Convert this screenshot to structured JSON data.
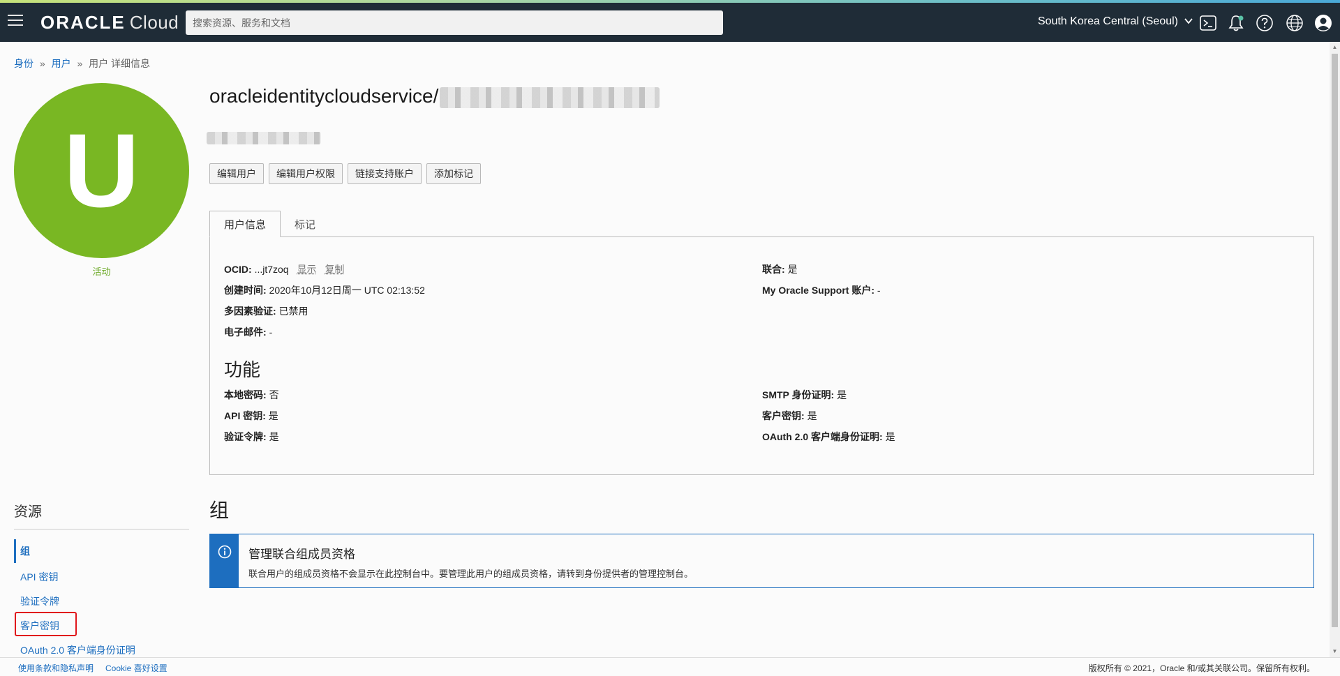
{
  "header": {
    "logo_brand": "ORACLE",
    "logo_product": "Cloud",
    "search_placeholder": "搜索资源、服务和文档",
    "region": "South Korea Central (Seoul)"
  },
  "breadcrumb": {
    "identity": "身份",
    "users": "用户",
    "current": "用户 详细信息",
    "separator": "»"
  },
  "user": {
    "avatar_letter": "U",
    "status": "活动",
    "title_prefix": "oracleidentitycloudservice/"
  },
  "actions": [
    "编辑用户",
    "编辑用户权限",
    "链接支持账户",
    "添加标记"
  ],
  "tabs": [
    "用户信息",
    "标记"
  ],
  "user_info": {
    "ocid_label": "OCID:",
    "ocid_value": "...jt7zoq",
    "show": "显示",
    "copy": "复制",
    "created_label": "创建时间:",
    "created_value": "2020年10月12日周一 UTC 02:13:52",
    "mfa_label": "多因素验证:",
    "mfa_value": "已禁用",
    "email_label": "电子邮件:",
    "email_value": "-",
    "federated_label": "联合:",
    "federated_value": "是",
    "mos_label": "My Oracle Support 账户:",
    "mos_value": "-"
  },
  "capabilities": {
    "heading": "功能",
    "local_password_label": "本地密码:",
    "local_password_value": "否",
    "api_keys_label": "API 密钥:",
    "api_keys_value": "是",
    "auth_tokens_label": "验证令牌:",
    "auth_tokens_value": "是",
    "smtp_label": "SMTP 身份证明:",
    "smtp_value": "是",
    "customer_keys_label": "客户密钥:",
    "customer_keys_value": "是",
    "oauth_label": "OAuth 2.0 客户端身份证明:",
    "oauth_value": "是"
  },
  "resources": {
    "title": "资源",
    "items": [
      "组",
      "API 密钥",
      "验证令牌",
      "客户密钥",
      "OAuth 2.0 客户端身份证明"
    ]
  },
  "groups": {
    "heading": "组",
    "info_title": "管理联合组成员资格",
    "info_text": "联合用户的组成员资格不会显示在此控制台中。要管理此用户的组成员资格，请转到身份提供者的管理控制台。"
  },
  "footer": {
    "terms": "使用条款和隐私声明",
    "cookies": "Cookie 喜好设置",
    "copyright": "版权所有 © 2021，Oracle 和/或其关联公司。保留所有权利。"
  },
  "colors": {
    "header_bg": "#1f2c37",
    "avatar": "#79b723",
    "link": "#1d6ebf",
    "highlight": "#e0151b"
  }
}
